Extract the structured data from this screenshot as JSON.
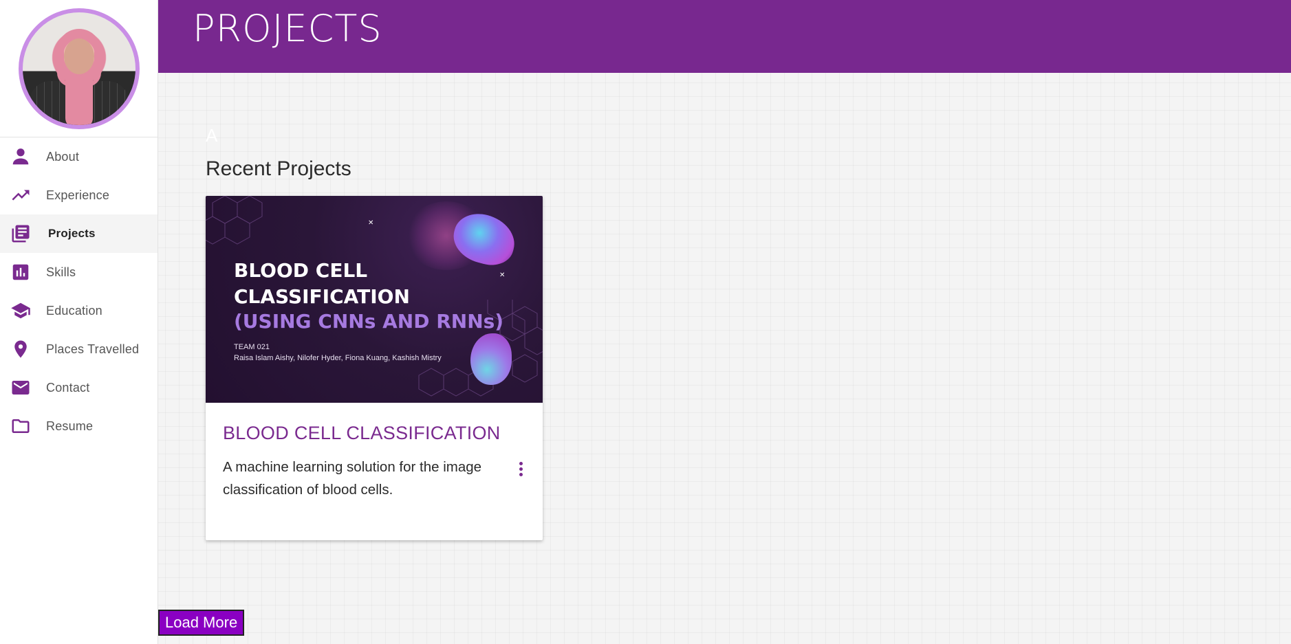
{
  "header": {
    "title": "PROJECTS"
  },
  "sidebar": {
    "items": [
      {
        "label": "About",
        "icon": "person-icon",
        "active": false
      },
      {
        "label": "Experience",
        "icon": "trending-up-icon",
        "active": false
      },
      {
        "label": "Projects",
        "icon": "library-books-icon",
        "active": true
      },
      {
        "label": "Skills",
        "icon": "bar-chart-icon",
        "active": false
      },
      {
        "label": "Education",
        "icon": "graduation-cap-icon",
        "active": false
      },
      {
        "label": "Places Travelled",
        "icon": "location-pin-icon",
        "active": false
      },
      {
        "label": "Contact",
        "icon": "mail-icon",
        "active": false
      },
      {
        "label": "Resume",
        "icon": "folder-icon",
        "active": false
      }
    ]
  },
  "main": {
    "ghost_letter": "A",
    "section_title": "Recent Projects",
    "projects": [
      {
        "media": {
          "title_line1": "BLOOD CELL",
          "title_line2": "CLASSIFICATION",
          "subtitle": "(USING CNNs AND RNNs)",
          "team": "TEAM 021",
          "authors": "Raisa Islam Aishy, Nilofer Hyder, Fiona Kuang, Kashish Mistry"
        },
        "title": "BLOOD CELL CLASSIFICATION",
        "description": "A machine learning solution for the image classification of blood cells."
      }
    ],
    "load_more_label": "Load More"
  },
  "colors": {
    "brand": "#78288f",
    "accent": "#7a2a8f",
    "button": "#8a00c2",
    "avatar_ring": "#c98ee6"
  }
}
